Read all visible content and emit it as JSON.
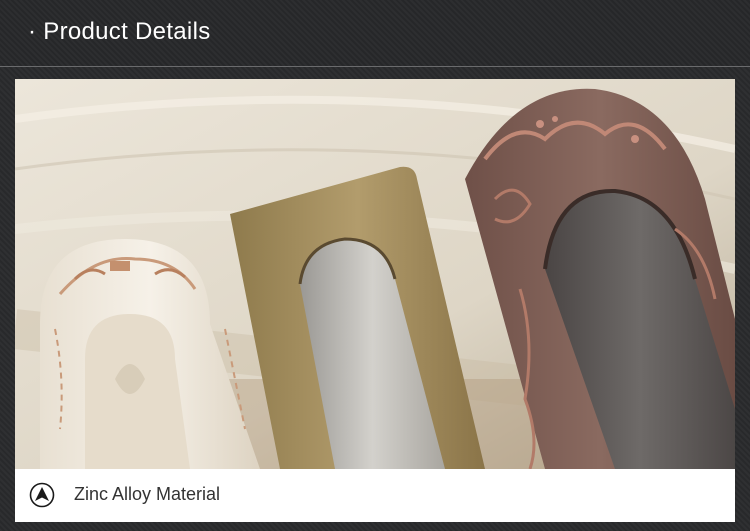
{
  "header": {
    "title": "· Product  Details"
  },
  "caption": {
    "icon": "navigation-arrow-icon",
    "text": "Zinc Alloy Material"
  },
  "colors": {
    "header_bg": "#2d2e30",
    "caption_bg": "#ffffff",
    "caption_text": "#333333",
    "bronze": "#a08a5a",
    "copper": "#7a5a50"
  }
}
